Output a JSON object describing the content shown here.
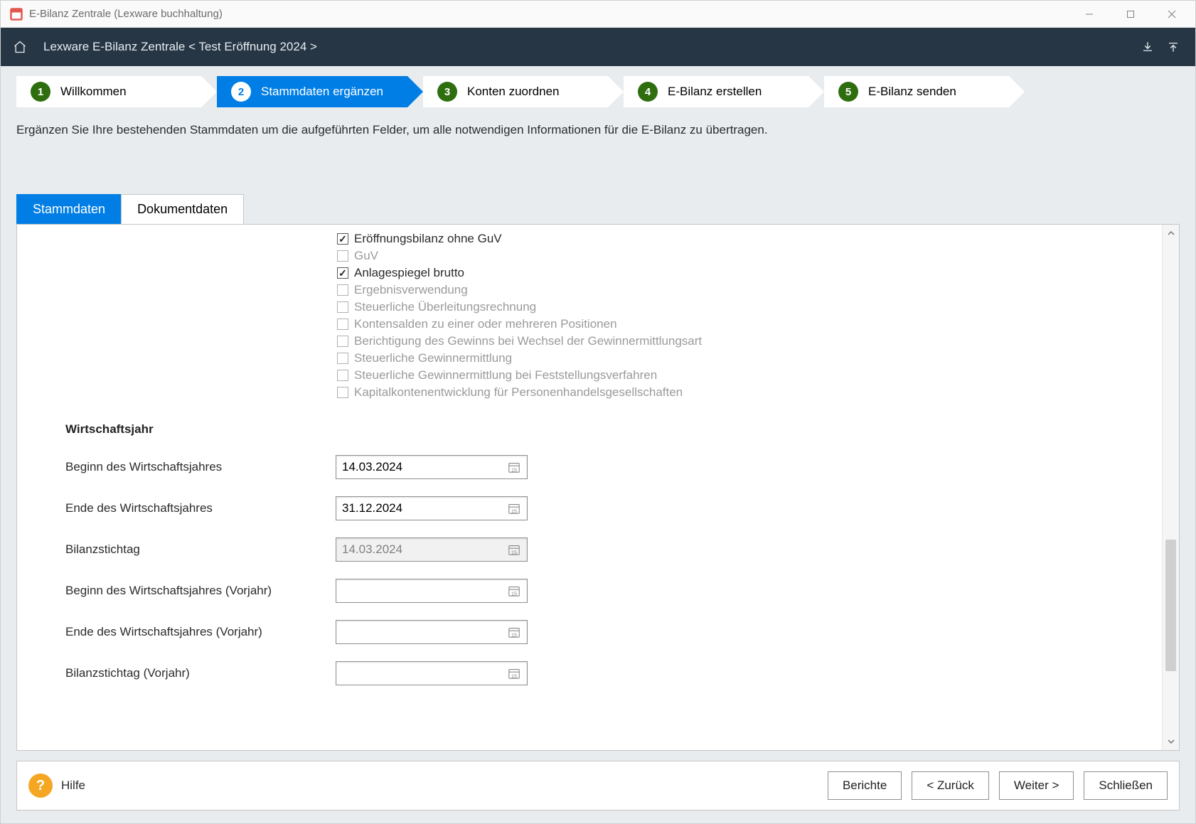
{
  "window": {
    "title": "E-Bilanz Zentrale (Lexware buchhaltung)"
  },
  "header": {
    "breadcrumb": "Lexware E-Bilanz Zentrale < Test Eröffnung 2024 >"
  },
  "wizard": {
    "steps": [
      {
        "num": "1",
        "label": "Willkommen",
        "active": false
      },
      {
        "num": "2",
        "label": "Stammdaten ergänzen",
        "active": true
      },
      {
        "num": "3",
        "label": "Konten zuordnen",
        "active": false
      },
      {
        "num": "4",
        "label": "E-Bilanz erstellen",
        "active": false
      },
      {
        "num": "5",
        "label": "E-Bilanz senden",
        "active": false
      }
    ]
  },
  "instruction": "Ergänzen Sie Ihre bestehenden Stammdaten um die aufgeführten Felder, um alle notwendigen Informationen für die E-Bilanz zu übertragen.",
  "tabs": {
    "stammdaten": "Stammdaten",
    "dokumentdaten": "Dokumentdaten"
  },
  "form": {
    "checks": [
      {
        "label": "Eröffnungsbilanz ohne GuV",
        "checked": true,
        "enabled": true
      },
      {
        "label": "GuV",
        "checked": false,
        "enabled": false
      },
      {
        "label": "Anlagespiegel brutto",
        "checked": true,
        "enabled": true
      },
      {
        "label": "Ergebnisverwendung",
        "checked": false,
        "enabled": false
      },
      {
        "label": "Steuerliche Überleitungsrechnung",
        "checked": false,
        "enabled": false
      },
      {
        "label": "Kontensalden zu einer oder mehreren Positionen",
        "checked": false,
        "enabled": false
      },
      {
        "label": "Berichtigung des Gewinns bei Wechsel der Gewinnermittlungsart",
        "checked": false,
        "enabled": false
      },
      {
        "label": "Steuerliche Gewinnermittlung",
        "checked": false,
        "enabled": false
      },
      {
        "label": "Steuerliche Gewinnermittlung bei Feststellungsverfahren",
        "checked": false,
        "enabled": false
      },
      {
        "label": "Kapitalkontenentwicklung für Personenhandelsgesellschaften",
        "checked": false,
        "enabled": false
      }
    ],
    "section_wj": "Wirtschaftsjahr",
    "fields": [
      {
        "label": "Beginn des Wirtschaftsjahres",
        "value": "14.03.2024",
        "readonly": false
      },
      {
        "label": "Ende des Wirtschaftsjahres",
        "value": "31.12.2024",
        "readonly": false
      },
      {
        "label": "Bilanzstichtag",
        "value": "14.03.2024",
        "readonly": true
      },
      {
        "label": "Beginn des Wirtschaftsjahres (Vorjahr)",
        "value": "",
        "readonly": false
      },
      {
        "label": "Ende des Wirtschaftsjahres (Vorjahr)",
        "value": "",
        "readonly": false
      },
      {
        "label": "Bilanzstichtag (Vorjahr)",
        "value": "",
        "readonly": false
      }
    ]
  },
  "footer": {
    "help": "Hilfe",
    "berichte": "Berichte",
    "back": "< Zurück",
    "next": "Weiter >",
    "close": "Schließen"
  }
}
